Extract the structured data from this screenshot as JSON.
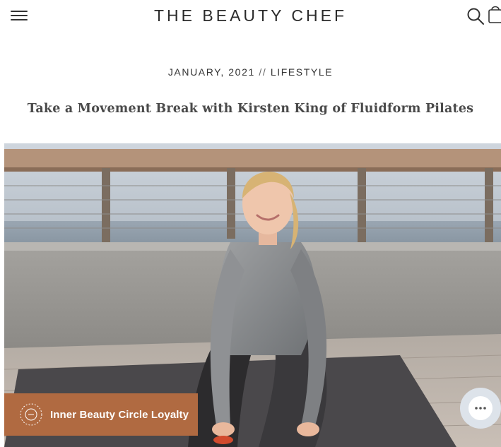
{
  "header": {
    "logo": "THE BEAUTY CHEF",
    "menu_icon": "hamburger-menu-icon",
    "search_icon": "search-icon",
    "cart_icon": "shopping-bag-icon"
  },
  "article": {
    "date": "JANUARY, 2021",
    "separator": "//",
    "category": "LIFESTYLE",
    "title": "Take a Movement Break with Kirsten King of Fluidform Pilates"
  },
  "hero": {
    "subject": "woman in grey top seated on yoga mat on terrace by the sea"
  },
  "loyalty": {
    "label": "Inner Beauty Circle Loyalty",
    "icon": "beauty-studio-badge-icon",
    "background": "#b06a41"
  },
  "chat": {
    "icon": "chat-bubble-icon"
  },
  "colors": {
    "text": "#333333",
    "accent": "#b06a41"
  }
}
